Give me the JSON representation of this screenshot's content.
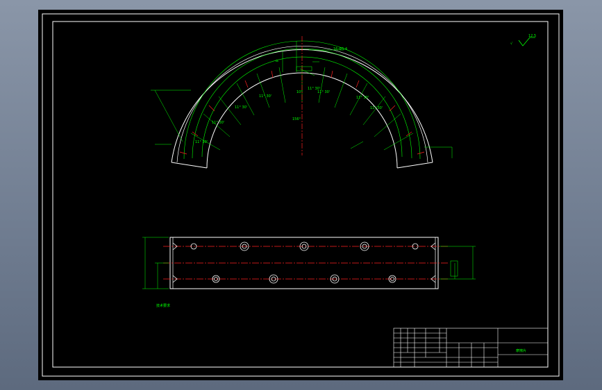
{
  "drawing": {
    "colors": {
      "part_outline": "#ffffff",
      "centerline": "#ff2020",
      "dimension": "#00ff00",
      "frame": "#ffffff",
      "background": "#000000",
      "window": "#7a869a"
    },
    "surface_finish": "12.5",
    "arc_view": {
      "labels": {
        "top_dim": "R",
        "top_note": "16-Φ5.4",
        "center_1": "10°",
        "center_2": "156°"
      },
      "segment_angles": [
        "11° 30'",
        "11° 30'",
        "11° 30'",
        "11° 30'",
        "11° 30'",
        "11° 30'",
        "11° 30'",
        "11° 30'"
      ]
    },
    "notes": [
      "技术要求",
      "",
      "",
      "",
      "",
      ""
    ],
    "title_block": {
      "part_name": "摩擦片",
      "scale": "",
      "material": ""
    }
  }
}
